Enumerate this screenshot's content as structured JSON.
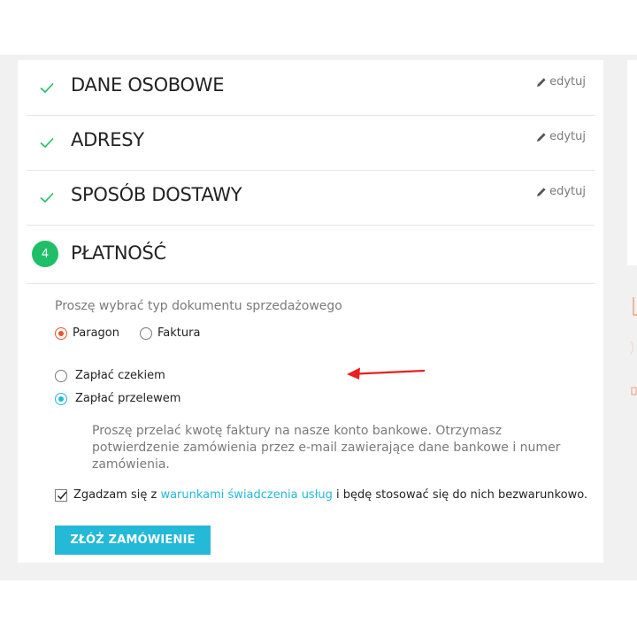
{
  "steps": [
    {
      "title": "DANE OSOBOWE",
      "edit_label": "edytuj",
      "status": "complete"
    },
    {
      "title": "ADRESY",
      "edit_label": "edytuj",
      "status": "complete"
    },
    {
      "title": "SPOSÓB DOSTAWY",
      "edit_label": "edytuj",
      "status": "complete"
    },
    {
      "title": "PŁATNOŚĆ",
      "number": "4",
      "status": "current"
    }
  ],
  "payment": {
    "document_type_label": "Proszę wybrać typ dokumentu sprzedażowego",
    "document_options": [
      {
        "label": "Paragon",
        "selected": true
      },
      {
        "label": "Faktura",
        "selected": false
      }
    ],
    "payment_options": [
      {
        "label": "Zapłać czekiem",
        "selected": false
      },
      {
        "label": "Zapłać przelewem",
        "selected": true
      }
    ],
    "transfer_description": "Proszę przelać kwotę faktury na nasze konto bankowe. Otrzymasz potwierdzenie zamówienia przez e-mail zawierające dane bankowe i numer zamówienia.",
    "terms": {
      "checked": true,
      "prefix": "Zgadzam się z ",
      "link_text": "warunkami świadczenia usług",
      "suffix": " i będę stosować się do nich bezwarunkowo."
    },
    "submit_label": "ZŁÓŻ ZAMÓWIENIE"
  },
  "colors": {
    "accent": "#24b9d7",
    "check_green": "#1fbf67",
    "radio_orange": "#e8552f",
    "annotation_red": "#e8201f"
  },
  "icons": {
    "complete_step": "check-icon",
    "edit": "pencil-icon",
    "annotation": "red-arrow-icon"
  }
}
